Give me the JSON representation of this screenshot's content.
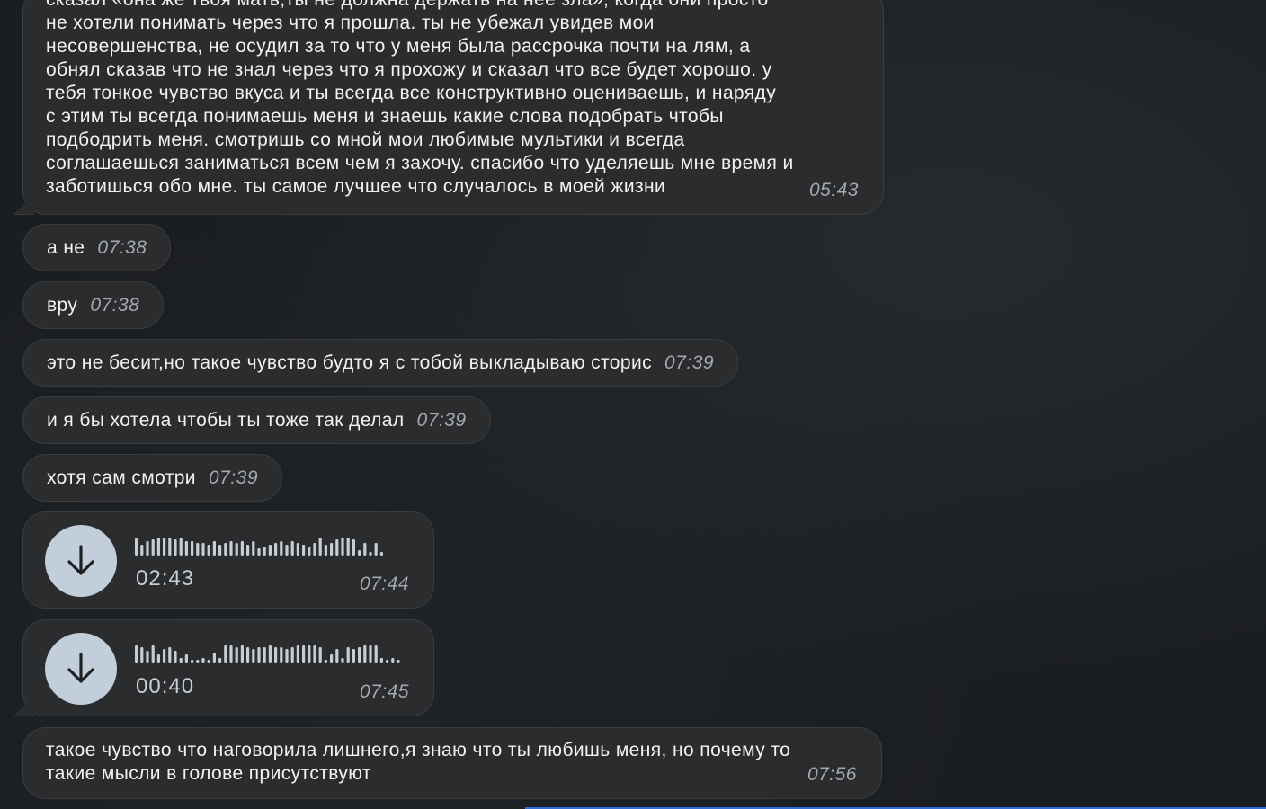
{
  "messages": {
    "m1": {
      "text": "сказал «она же твоя мать,ты не должна держать на нее зла», когда они просто\nне хотели понимать через что я прошла. ты не убежал увидев мои\nнесовершенства, не осудил за то что у меня была рассрочка почти на лям, а\nобнял сказав что не знал через что я прохожу и сказал что все будет хорошо. у\nтебя тонкое чувство вкуса и ты всегда все конструктивно оцениваешь, и наряду\nс этим ты всегда понимаешь меня и знаешь какие слова подобрать чтобы\nподбодрить меня. смотришь со мной мои любимые мультики и всегда\nсоглашаешься заниматься всем чем я захочу. спасибо что уделяешь мне время и\nзаботишься обо мне. ты самое лучшее что случалось в моей жизни",
      "time": "05:43"
    },
    "m2": {
      "text": "а не",
      "time": "07:38"
    },
    "m3": {
      "text": "вру",
      "time": "07:38"
    },
    "m4": {
      "text": "это не бесит,но такое чувство будто я с тобой выкладываю сторис",
      "time": "07:39"
    },
    "m5": {
      "text": "и я бы хотела чтобы ты тоже так делал",
      "time": "07:39"
    },
    "m6": {
      "text": "хотя сам смотри",
      "time": "07:39"
    },
    "v1": {
      "duration": "02:43",
      "time": "07:44",
      "icon": "download-arrow-icon"
    },
    "v2": {
      "duration": "00:40",
      "time": "07:45",
      "icon": "download-arrow-icon"
    },
    "m7": {
      "text": "такое чувство что наговорила лишнего,я знаю что ты любишь меня, но почему то\nтакие мысли в голове присутствуют",
      "time": "07:56"
    }
  },
  "colors": {
    "bubble": "#2a2c2e",
    "text": "#f2f2f2",
    "timestamp": "#a4a8ad",
    "download_button": "#c3cedb",
    "waveform": "#c7cdd3"
  }
}
